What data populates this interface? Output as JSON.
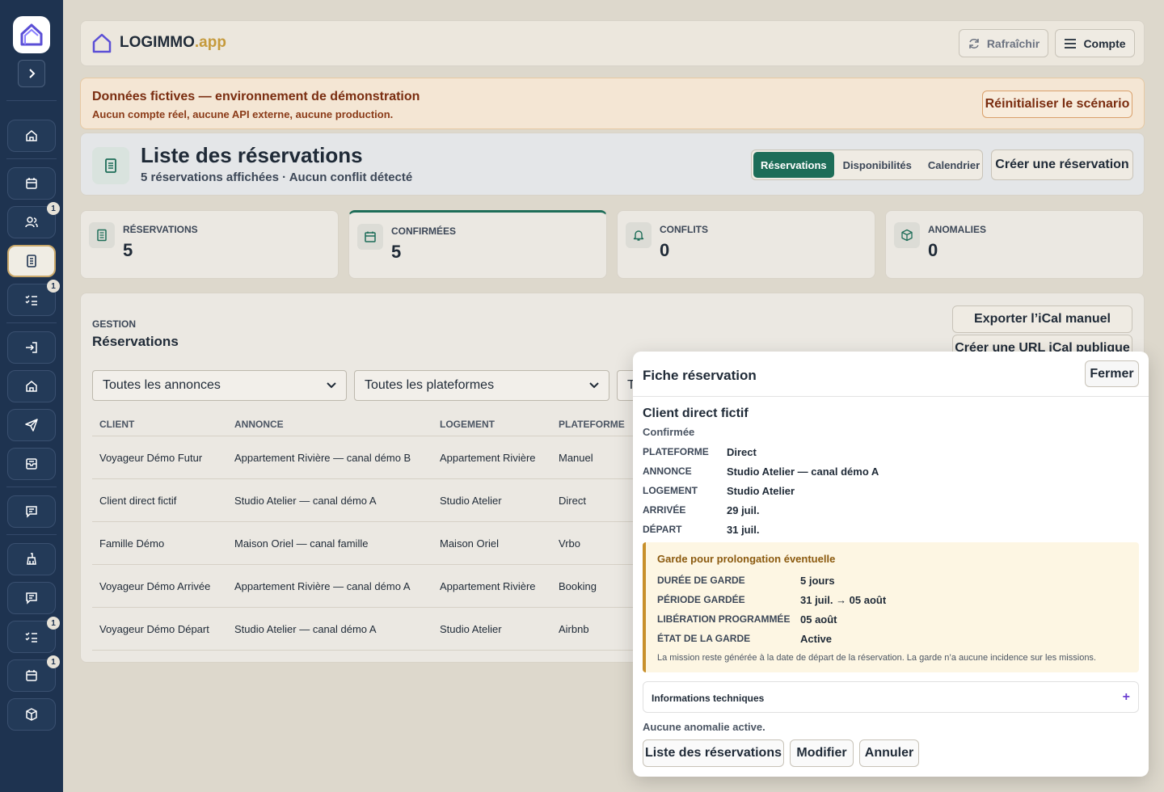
{
  "brand": {
    "name": "LOGIMMO",
    "suffix": ".app"
  },
  "topbar": {
    "refresh_label": "Rafraîchir",
    "account_label": "Compte"
  },
  "banner": {
    "title": "Données fictives — environnement de démonstration",
    "subtitle": "Aucun compte réel, aucune API externe, aucune production.",
    "reset_label": "Réinitialiser le scénario"
  },
  "page": {
    "title": "Liste des réservations",
    "subtitle": "5 réservations affichées · Aucun conflit détecté",
    "tabs": [
      "Réservations",
      "Disponibilités",
      "Calendrier"
    ],
    "active_tab": "Réservations",
    "create_label": "Créer une réservation"
  },
  "sidebar": {
    "badges": [
      "1",
      "1",
      "1",
      "1"
    ]
  },
  "stats": [
    {
      "label": "RÉSERVATIONS",
      "value": "5",
      "icon": "document-icon"
    },
    {
      "label": "CONFIRMÉES",
      "value": "5",
      "icon": "calendar-icon"
    },
    {
      "label": "CONFLITS",
      "value": "0",
      "icon": "bell-icon"
    },
    {
      "label": "ANOMALIES",
      "value": "0",
      "icon": "box-icon"
    }
  ],
  "main": {
    "eyebrow": "GESTION",
    "title": "Réservations",
    "export_label": "Exporter l’iCal manuel",
    "create_url_label": "Créer une URL iCal publique",
    "filters": [
      "Toutes les annonces",
      "Toutes les plateformes",
      "T"
    ],
    "columns": [
      "CLIENT",
      "ANNONCE",
      "LOGEMENT",
      "PLATEFORME"
    ],
    "rows": [
      [
        "Voyageur Démo Futur",
        "Appartement Rivière — canal démo B",
        "Appartement Rivière",
        "Manuel"
      ],
      [
        "Client direct fictif",
        "Studio Atelier — canal démo A",
        "Studio Atelier",
        "Direct"
      ],
      [
        "Famille Démo",
        "Maison Oriel — canal famille",
        "Maison Oriel",
        "Vrbo"
      ],
      [
        "Voyageur Démo Arrivée",
        "Appartement Rivière — canal démo A",
        "Appartement Rivière",
        "Booking"
      ],
      [
        "Voyageur Démo Départ",
        "Studio Atelier — canal démo A",
        "Studio Atelier",
        "Airbnb"
      ]
    ]
  },
  "drawer": {
    "title": "Fiche réservation",
    "close_label": "Fermer",
    "client": "Client direct fictif",
    "status": "Confirmée",
    "fields": [
      {
        "label": "PLATEFORME",
        "value": "Direct"
      },
      {
        "label": "ANNONCE",
        "value": "Studio Atelier — canal démo A"
      },
      {
        "label": "LOGEMENT",
        "value": "Studio Atelier"
      },
      {
        "label": "ARRIVÉE",
        "value": "29 juil."
      },
      {
        "label": "DÉPART",
        "value": "31 juil."
      }
    ],
    "hold": {
      "title": "Garde pour prolongation éventuelle",
      "fields": [
        {
          "label": "DURÉE DE GARDE",
          "value": "5 jours"
        },
        {
          "label": "PÉRIODE GARDÉE",
          "value": "31 juil. → 05 août"
        },
        {
          "label": "LIBÉRATION PROGRAMMÉE",
          "value": "05 août"
        },
        {
          "label": "ÉTAT DE LA GARDE",
          "value": "Active"
        }
      ],
      "note": "La mission reste générée à la date de départ de la réservation. La garde n’a aucune incidence sur les missions."
    },
    "tech_label": "Informations techniques",
    "tech_toggle": "+",
    "no_anomaly": "Aucune anomalie active.",
    "actions": [
      "Liste des réservations",
      "Modifier",
      "Annuler"
    ]
  }
}
